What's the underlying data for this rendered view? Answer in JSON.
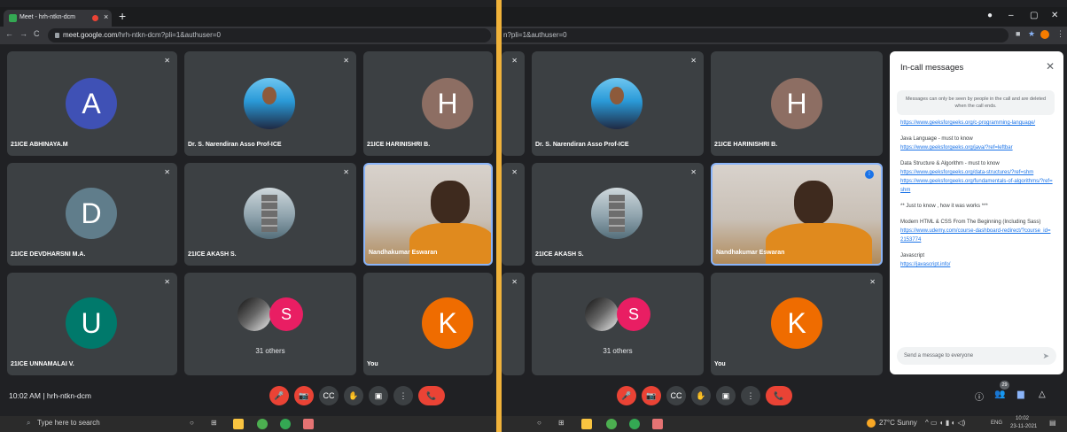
{
  "browser": {
    "tab_title": "Meet - hrh-ntkn-dcm",
    "tab_close": "×",
    "new_tab": "+",
    "url_host": "meet.google.com",
    "url_path": "/hrh-ntkn-dcm?pli=1&authuser=0",
    "url_path_right": "n?pli=1&authuser=0",
    "window_controls": [
      "–",
      "▢",
      "✕"
    ]
  },
  "tiles": [
    {
      "name": "21ICE ABHINAYA.M",
      "initial": "A",
      "color": "#3f51b5"
    },
    {
      "name": "Dr. S. Narendiran Asso Prof-ICE",
      "type": "photo"
    },
    {
      "name": "21ICE HARINISHRI B.",
      "initial": "H",
      "color": "#8d6e63"
    },
    {
      "name": "21ICE DEVDHARSNI M.A.",
      "initial": "D",
      "color": "#607d8b"
    },
    {
      "name": "21ICE AKASH S.",
      "type": "photo"
    },
    {
      "name": "Nandhakumar Eswaran",
      "type": "video"
    },
    {
      "name": "21ICE UNNAMALAI V.",
      "initial": "U",
      "color": "#00796b"
    },
    {
      "name": "",
      "others": "31 others",
      "initial": "S",
      "color": "#e91e63"
    },
    {
      "name": "You",
      "initial": "K",
      "color": "#ef6c00"
    }
  ],
  "meeting": {
    "time": "10:02 AM",
    "separator": "|",
    "code": "hrh-ntkn-dcm",
    "people_count": "29"
  },
  "controls": {
    "mic": "🎤",
    "camera": "📷",
    "captions": "CC",
    "hand": "✋",
    "present": "▣",
    "more": "⋮",
    "end": "📞"
  },
  "chat": {
    "title": "In-call messages",
    "notice": "Messages can only be seen by people in the call and are deleted when the call ends.",
    "messages": [
      {
        "text": "",
        "links": [
          "https://www.geeksforgeeks.org/c-programming-language/"
        ]
      },
      {
        "text": "Java Language - must to know",
        "links": [
          "https://www.geeksforgeeks.org/java/?ref=leftbar"
        ]
      },
      {
        "text": "Data Structure & Algorithm - must to know",
        "links": [
          "https://www.geeksforgeeks.org/data-structures/?ref=shm",
          "https://www.geeksforgeeks.org/fundamentals-of-algorithms/?ref=shm"
        ]
      },
      {
        "text": "** Just to know , how it was works ***",
        "links": []
      },
      {
        "text": "Modern HTML & CSS From The Beginning (Including Sass)",
        "links": [
          "https://www.udemy.com/course-dashboard-redirect/?course_id=2153774"
        ]
      },
      {
        "text": "Javascript",
        "links": [
          "https://javascript.info/"
        ]
      }
    ],
    "input_placeholder": "Send a message to everyone"
  },
  "taskbar": {
    "search": "Type here to search",
    "weather": "27°C  Sunny",
    "lang": "ENG",
    "time": "10:02",
    "date": "23-11-2021"
  },
  "colors": {
    "background": "#f0b23a",
    "meet_bg": "#202124",
    "tile_bg": "#3c4043",
    "danger": "#ea4335",
    "accent": "#1a73e8"
  }
}
